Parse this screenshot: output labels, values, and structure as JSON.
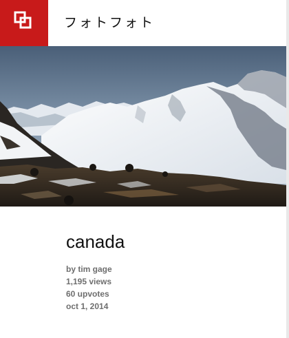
{
  "colors": {
    "brand": "#c81a1a",
    "meta_text": "#6e6e6e"
  },
  "header": {
    "logo_icon": "overlapping-squares-icon",
    "title": "フォトフォト"
  },
  "photo": {
    "image_subject": "snowy-mountains",
    "title": "canada",
    "author": "by tim gage",
    "views": "1,195 views",
    "upvotes": "60 upvotes",
    "date": "oct 1, 2014"
  }
}
